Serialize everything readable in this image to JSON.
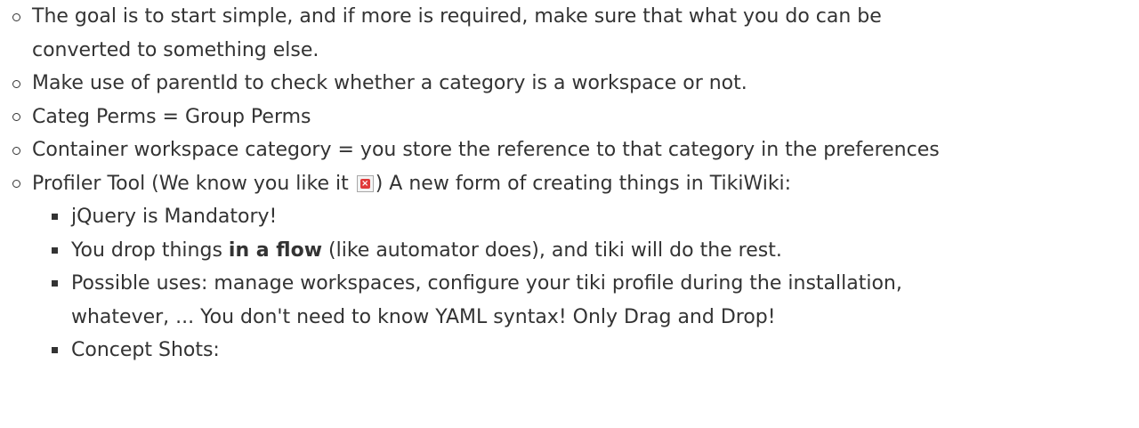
{
  "items": [
    {
      "text_line1": "The goal is to start simple, and if more is required, make sure that what you do can be",
      "text_line2": "converted to something else."
    },
    {
      "text": "Make use of parentId to check whether a category is a workspace or not."
    },
    {
      "text": "Categ Perms = Group Perms"
    },
    {
      "text": "Container workspace category = you store the reference to that category in the preferences"
    },
    {
      "text_before_icon": "Profiler Tool (We know you like it ",
      "icon": "broken-image-icon",
      "text_after_icon": ") A new form of creating things in TikiWiki:",
      "subitems": [
        {
          "text": "jQuery is Mandatory!"
        },
        {
          "text_before_bold": "You drop things ",
          "bold": "in a flow",
          "text_after_bold": " (like automator does), and tiki will do the rest."
        },
        {
          "text_line1": "Possible uses: manage workspaces, configure your tiki profile during the installation,",
          "text_line2": "whatever, ... You don't need to know YAML syntax! Only Drag and Drop!"
        },
        {
          "text": "Concept Shots:"
        }
      ]
    }
  ]
}
